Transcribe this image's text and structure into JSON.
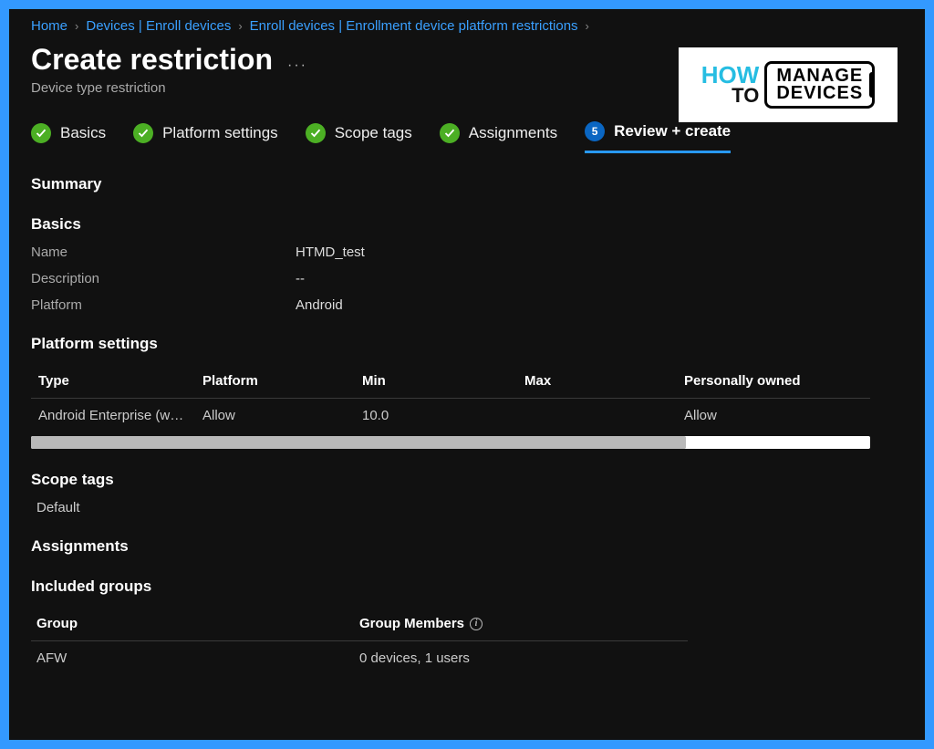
{
  "breadcrumb": {
    "items": [
      "Home",
      "Devices | Enroll devices",
      "Enroll devices | Enrollment device platform restrictions"
    ]
  },
  "page": {
    "title": "Create restriction",
    "subtitle": "Device type restriction"
  },
  "logo": {
    "how": "HOW",
    "to": "TO",
    "line1": "MANAGE",
    "line2": "DEVICES"
  },
  "tabs": [
    {
      "label": "Basics",
      "state": "done"
    },
    {
      "label": "Platform settings",
      "state": "done"
    },
    {
      "label": "Scope tags",
      "state": "done"
    },
    {
      "label": "Assignments",
      "state": "done"
    },
    {
      "label": "Review + create",
      "state": "current",
      "number": "5"
    }
  ],
  "summary": {
    "heading": "Summary"
  },
  "basics": {
    "heading": "Basics",
    "rows": {
      "name_label": "Name",
      "name_value": "HTMD_test",
      "desc_label": "Description",
      "desc_value": "--",
      "plat_label": "Platform",
      "plat_value": "Android"
    }
  },
  "platform_settings": {
    "heading": "Platform settings",
    "columns": {
      "type": "Type",
      "platform": "Platform",
      "min": "Min",
      "max": "Max",
      "po": "Personally owned"
    },
    "rows": [
      {
        "type": "Android Enterprise (w…",
        "platform": "Allow",
        "min": "10.0",
        "max": "",
        "po": "Allow"
      }
    ]
  },
  "scope_tags": {
    "heading": "Scope tags",
    "value": "Default"
  },
  "assignments": {
    "heading": "Assignments"
  },
  "included_groups": {
    "heading": "Included groups",
    "columns": {
      "group": "Group",
      "members": "Group Members"
    },
    "rows": [
      {
        "group": "AFW",
        "members": "0 devices, 1 users"
      }
    ]
  }
}
